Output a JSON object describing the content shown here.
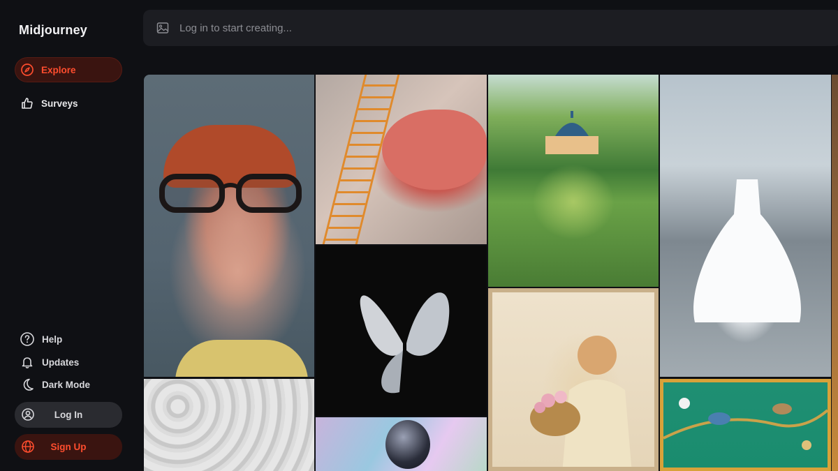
{
  "app": {
    "brand": "Midjourney"
  },
  "sidebar": {
    "nav": [
      {
        "label": "Explore",
        "icon": "compass-icon",
        "active": true
      },
      {
        "label": "Surveys",
        "icon": "thumbs-up-icon",
        "active": false
      }
    ],
    "bottom": [
      {
        "label": "Help",
        "icon": "help-icon"
      },
      {
        "label": "Updates",
        "icon": "bell-icon"
      },
      {
        "label": "Dark Mode",
        "icon": "moon-icon"
      }
    ],
    "login_label": "Log In",
    "signup_label": "Sign Up"
  },
  "search": {
    "placeholder": "Log in to start creating..."
  },
  "colors": {
    "background": "#0f1014",
    "accent": "#ff4d2e",
    "accent_bg": "#3a1410",
    "panel": "#1c1d22"
  },
  "gallery": {
    "tiles": [
      {
        "icon": "portrait-image"
      },
      {
        "icon": "lips-miniature-workers-image"
      },
      {
        "icon": "crystal-butterfly-image"
      },
      {
        "icon": "astronaut-helmet-image"
      },
      {
        "icon": "white-horses-image"
      },
      {
        "icon": "park-palace-illustration-image"
      },
      {
        "icon": "girl-with-flower-basket-image"
      },
      {
        "icon": "wedding-dress-hall-image"
      },
      {
        "icon": "birds-tapestry-image"
      },
      {
        "icon": "partial-edge-image"
      }
    ]
  }
}
